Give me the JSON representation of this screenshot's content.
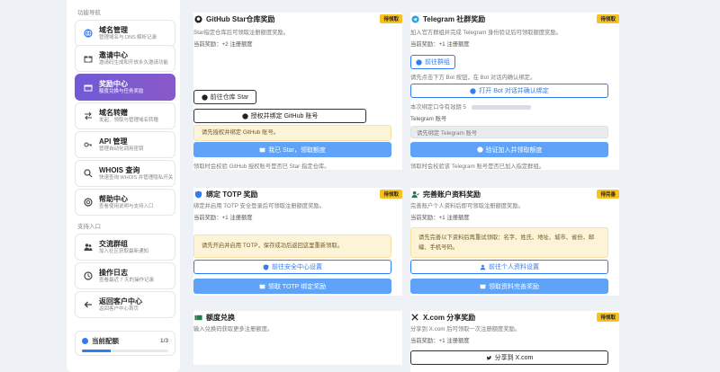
{
  "sidebar": {
    "section_nav": "功能导航",
    "items": [
      {
        "label": "域名管理",
        "desc": "管理域名与 DNS 解析记录"
      },
      {
        "label": "邀请中心",
        "desc": "邀请码生成和开放永久邀请功能"
      },
      {
        "label": "奖励中心",
        "desc": "额度兑换与任务奖励"
      },
      {
        "label": "域名转赠",
        "desc": "发起、领取与管理域名转赠"
      },
      {
        "label": "API 管理",
        "desc": "管理自动化调用密钥"
      },
      {
        "label": "WHOIS 查询",
        "desc": "快速查询 WHOIS 并管理隐私开关"
      },
      {
        "label": "帮助中心",
        "desc": "查看使用说明与支持入口"
      }
    ],
    "section_support": "支持入口",
    "support_items": [
      {
        "label": "交流群组",
        "desc": "加入社区获取最新通知"
      },
      {
        "label": "操作日志",
        "desc": "查看最近 7 天的操作记录"
      },
      {
        "label": "返回客户中心",
        "desc": "返回客户中心首页"
      }
    ],
    "quota": {
      "label": "当前配额",
      "value": "1/3",
      "fraction": 0.3333
    }
  },
  "cards": {
    "github": {
      "title": "GitHub Star仓库奖励",
      "badge": "待领取",
      "desc": "Star指定仓库后可领取注册额度奖励。",
      "reward": "当前奖励：+2 注册额度",
      "repo_button": "前往仓库 Star",
      "bind_button": "授权并绑定 GitHub 账号",
      "notice": "请先授权并绑定 GitHub 账号。",
      "claim_button": "我已 Star，领取额度",
      "footer": "领取时会校验 GitHub 授权账号是否已 Star 指定仓库。"
    },
    "telegram": {
      "title": "Telegram 社群奖励",
      "badge": "待领取",
      "desc": "加入官方群组并完成 Telegram 身份验证后可领取额度奖励。",
      "reward": "当前奖励：+1 注册额度",
      "group_button": "前往群组",
      "hint": "请先点击下方 Bot 按钮，在 Bot 对话内确认绑定。",
      "bot_button": "打开 Bot 对话并确认绑定",
      "code_label": "本次绑定口令有效期 5",
      "account_label": "Telegram 账号",
      "account_placeholder": "请先绑定 Telegram 账号",
      "verify_button": "验证加入并领取额度",
      "footer": "领取时会校验该 Telegram 账号是否已加入指定群组。"
    },
    "totp": {
      "title": "绑定 TOTP 奖励",
      "badge": "待领取",
      "desc": "绑定并启用 TOTP 安全登录后可领取注册额度奖励。",
      "reward": "当前奖励：+1 注册额度",
      "notice": "请先开启并启用 TOTP，保存成功后返回这里重新领取。",
      "security_button": "前往安全中心设置",
      "claim_button": "领取 TOTP 绑定奖励"
    },
    "profile": {
      "title": "完善账户资料奖励",
      "badge": "待完善",
      "desc": "完善账户个人资料后即可领取注册额度奖励。",
      "reward": "当前奖励：+1 注册额度",
      "notice": "请先完善以下资料后再重试领取：名字、姓氏、地址、城市、省份、邮编、手机号码。",
      "center_button": "前往个人资料设置",
      "claim_button": "领取资料完善奖励"
    },
    "redeem": {
      "title": "额度兑换",
      "desc": "输入兑换码获取更多注册额度。"
    },
    "xcom": {
      "title": "X.com 分享奖励",
      "badge": "待领取",
      "desc": "分享到 X.com 后可领取一次注册额度奖励。",
      "reward": "当前奖励：+1 注册额度",
      "share_button": "分享到 X.com"
    }
  }
}
